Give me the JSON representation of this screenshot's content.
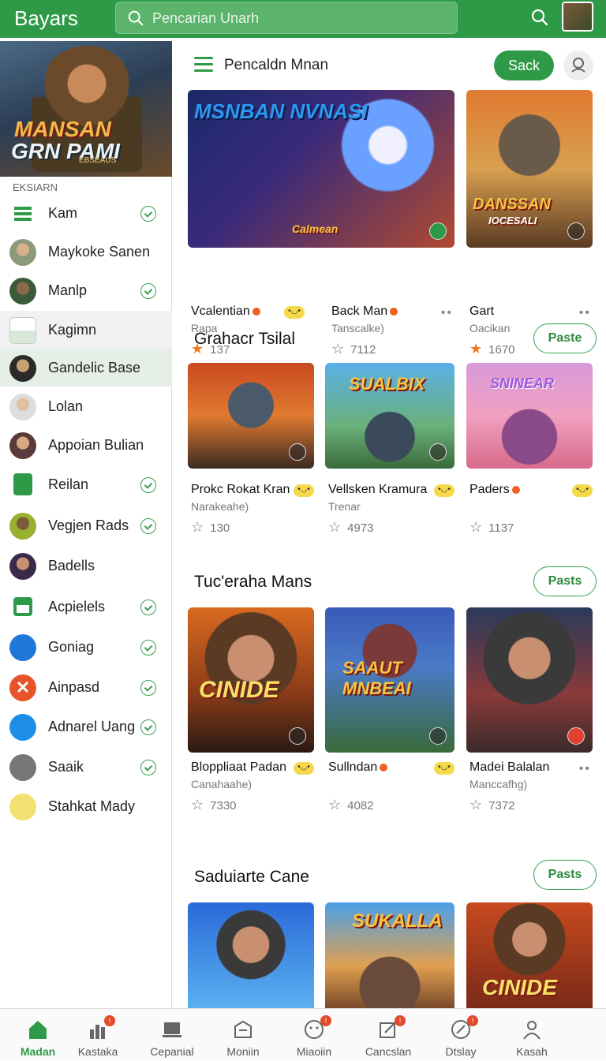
{
  "topbar": {
    "brand": "Bayars",
    "search_placeholder": "Pencarian Unarh",
    "colors": {
      "primary": "#2e9a47"
    }
  },
  "sidebar": {
    "banner": {
      "line1": "MANSAN",
      "line2": "GRN PAMI",
      "line3": "EBSEAUS"
    },
    "section_label": "EKSIARN",
    "items": [
      {
        "label": "Kam",
        "icon": "grid-icon",
        "badge": true
      },
      {
        "label": "Maykoke Sanen",
        "icon": "avatar",
        "badge": false
      },
      {
        "label": "Manlp",
        "icon": "avatar",
        "badge": true
      },
      {
        "label": "Kagimn",
        "icon": "app-icon",
        "badge": false
      },
      {
        "label": "Gandelic Base",
        "icon": "avatar",
        "badge": false
      },
      {
        "label": "Lolan",
        "icon": "avatar",
        "badge": false
      },
      {
        "label": "Appoian Bulian",
        "icon": "avatar",
        "badge": false
      },
      {
        "label": "Reilan",
        "icon": "app-icon",
        "badge": true
      },
      {
        "label": "Vegjen Rads",
        "icon": "avatar",
        "badge": true
      },
      {
        "label": "Badells",
        "icon": "avatar",
        "badge": false
      },
      {
        "label": "Acpielels",
        "icon": "calendar-icon",
        "badge": true
      },
      {
        "label": "Goniag",
        "icon": "book-icon",
        "badge": true
      },
      {
        "label": "Ainpasd",
        "icon": "x-icon",
        "badge": true
      },
      {
        "label": "Adnarel Uang",
        "icon": "bird-icon",
        "badge": true
      },
      {
        "label": "Saaik",
        "icon": "list-icon",
        "badge": true
      },
      {
        "label": "Stahkat Mady",
        "icon": "leaf-icon",
        "badge": false
      }
    ]
  },
  "main": {
    "title": "Pencaldn Mnan",
    "sack_label": "Sack",
    "row1": [
      {
        "name": "Vcalentian",
        "sub": "Rapa",
        "rating": "137",
        "art": "MSNBAN NVNASI",
        "art2": "Calmean"
      },
      {
        "name": "Back Man",
        "sub": "Tanscalke)",
        "rating": "7112",
        "art": "",
        "art2": ""
      },
      {
        "name": "Gart",
        "sub": "Oacikan",
        "rating": "1670",
        "art": "DANSSAN",
        "art2": "IOCESALI"
      }
    ],
    "sections": [
      {
        "title": "Grahacr Tsilal",
        "paste": "Paste",
        "cards": [
          {
            "name": "Prokc Rokat Kran",
            "sub": "Narakeahe)",
            "rating": "130",
            "art": ""
          },
          {
            "name": "Vellsken Kramura",
            "sub": "Trenar",
            "rating": "4973",
            "art": "SUALBIX"
          },
          {
            "name": "Paders",
            "sub": "",
            "rating": "1137",
            "art": "SNINEAR"
          }
        ]
      },
      {
        "title": "Tuc'eraha Mans",
        "paste": "Pasts",
        "cards": [
          {
            "name": "Bloppliaat Padan",
            "sub": "Canahaahe)",
            "rating": "7330",
            "art": "CINIDE"
          },
          {
            "name": "Sullndan",
            "sub": "",
            "rating": "4082",
            "art": "SAAUT MNBEAI"
          },
          {
            "name": "Madei Balalan",
            "sub": "Manccafhg)",
            "rating": "7372",
            "art": ""
          }
        ]
      },
      {
        "title": "Saduiarte Cane",
        "paste": "Pasts",
        "cards": [
          {
            "art": ""
          },
          {
            "art": "SUKALLA"
          },
          {
            "art": "CINIDE"
          }
        ]
      }
    ]
  },
  "bottomnav": [
    {
      "label": "Madan",
      "icon": "home-icon",
      "active": true
    },
    {
      "label": "Kastaka",
      "icon": "chart-icon",
      "active": false
    },
    {
      "label": "Cepanial",
      "icon": "laptop-icon",
      "active": false
    },
    {
      "label": "Moniin",
      "icon": "robot-icon",
      "active": false
    },
    {
      "label": "Miaoiin",
      "icon": "face-icon",
      "active": false
    },
    {
      "label": "Cancslan",
      "icon": "edit-icon",
      "active": false
    },
    {
      "label": "Dtslay",
      "icon": "compass-icon",
      "active": false
    },
    {
      "label": "Kasah",
      "icon": "person-icon",
      "active": false
    }
  ]
}
